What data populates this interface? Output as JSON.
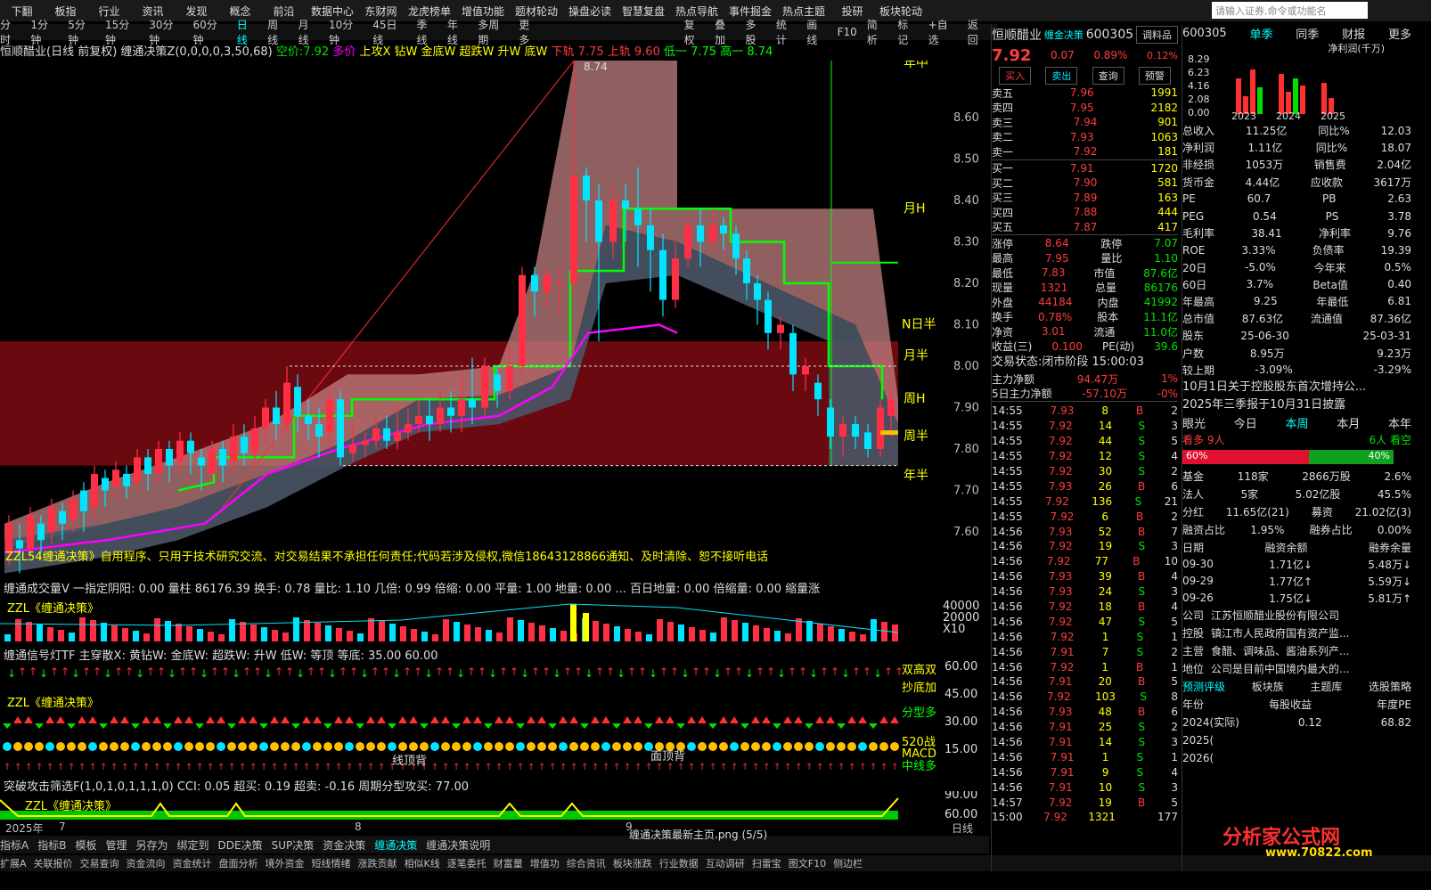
{
  "toolbar": {
    "items": [
      "下翻",
      "板指",
      "行业",
      "资讯",
      "发现",
      "概念",
      "前沿",
      "数据中心",
      "东财网",
      "龙虎榜单",
      "增值功能",
      "题材轮动",
      "操盘必读",
      "智慧复盘",
      "热点导航",
      "事件掘金",
      "热点主题",
      "投研",
      "板块轮动"
    ],
    "search_placeholder": "请输入证券,命令或功能名"
  },
  "periods": [
    "分时",
    "1分钟",
    "5分钟",
    "15分钟",
    "30分钟",
    "60分钟",
    "日线",
    "周线",
    "月线",
    "10分钟",
    "45日线",
    "季线",
    "年线",
    "多周期",
    "更多"
  ],
  "period_tools": [
    "复权",
    "叠加",
    "多股",
    "统计",
    "画线",
    "F10",
    "简析",
    "标记",
    "+自选",
    "返回"
  ],
  "title": {
    "name": "恒顺醋业(日线 前复权)",
    "indicator": "缠通决策Z(0,0,0,0,3,50,68)",
    "price_label": "空价:",
    "price": "7.92",
    "tags": [
      "多价",
      "上攻X",
      "钻W",
      "金底W",
      "超跌W",
      "升W",
      "底W",
      "下轨",
      "7.75",
      "上轨",
      "9.60",
      "低一",
      "7.75",
      "高一",
      "8.74"
    ]
  },
  "price_axis": [
    "8.60",
    "8.50",
    "8.40",
    "8.30",
    "8.20",
    "8.10",
    "8.00",
    "7.90",
    "7.80",
    "7.70",
    "7.60"
  ],
  "chart_data": {
    "type": "candlestick",
    "high_label": "8.74",
    "level_labels": [
      "年中",
      "月H",
      "N日半",
      "月半",
      "周H",
      "周半",
      "年半"
    ]
  },
  "disclaimer": "ZZL54缠通决策》自用程序、只用于技术研究交流、对交易结果不承担任何责任;代码若涉及侵权,微信18643128866通知、及时清除、恕不接听电话",
  "vol_title": "缠通成交量V 一指定阴阳: 0.00 量柱 86176.39 换手: 0.78 量比: 1.10 几倍: 0.99 倍缩: 0.00 平量: 1.00 地量: 0.00 ... 百日地量: 0.00 倍缩量: 0.00 缩量涨",
  "vol_sub": "ZZL《缠通决策》",
  "vol_axis": [
    "40000",
    "20000",
    "X10"
  ],
  "sig_title": "缠通信号灯TF 主穿散X: 黄钻W: 金底W: 超跌W: 升W 低W: 等顶 等底: 35.00 60.00",
  "sig_sub": "ZZL《缠通决策》",
  "sig_axis": [
    "60.00",
    "45.00",
    "30.00",
    "15.00"
  ],
  "sig_labels": [
    "双高双",
    "抄底加",
    "分型多",
    "520战",
    "MACD",
    "中线多",
    "线顶背",
    "面顶背"
  ],
  "cci_title": "突破攻击筛选F(1,0,1,0,1,1,1,0) CCI: 0.05 超买: 0.19 超卖: -0.16 周期分型攻买: 77.00",
  "cci_sub": "ZZL《缠通决策》",
  "cci_axis": [
    "90.00",
    "60.00"
  ],
  "time_axis": [
    "2025年",
    "7",
    "8",
    "9"
  ],
  "time_right": "日线",
  "tabs": [
    "指标A",
    "指标B",
    "模板",
    "管理",
    "另存为",
    "绑定到",
    "DDE决策",
    "SUP决策",
    "资金决策",
    "缠通决策",
    "缠通决策说明"
  ],
  "file_label": "缠通决策最新主页.png (5/5)",
  "bottom_tabs": [
    "扩展A",
    "关联报价",
    "交易查询",
    "资金流向",
    "资金统计",
    "盘面分析",
    "境外资金",
    "短线情绪",
    "涨跌贡献",
    "相似K线",
    "逐笔委托",
    "财富量",
    "增值功",
    "综合资讯",
    "板块涨跌",
    "行业数据",
    "互动调研",
    "扫雷宝",
    "图文F10",
    "侧边栏"
  ],
  "quote": {
    "name": "恒顺醋业",
    "tag": "缠金决策",
    "code": "600305",
    "rz": "R",
    "mode": "调料品",
    "price": "7.92",
    "chg": "0.07",
    "pct": "0.89%",
    "pct2": "0.12%",
    "buttons": [
      "买入",
      "卖出",
      "查询",
      "预警"
    ],
    "asks": [
      [
        "卖五",
        "7.96",
        "1991"
      ],
      [
        "卖四",
        "7.95",
        "2182"
      ],
      [
        "卖三",
        "7.94",
        "901"
      ],
      [
        "卖二",
        "7.93",
        "1063"
      ],
      [
        "卖一",
        "7.92",
        "181"
      ]
    ],
    "bids": [
      [
        "买一",
        "7.91",
        "1720"
      ],
      [
        "买二",
        "7.90",
        "581"
      ],
      [
        "买三",
        "7.89",
        "163"
      ],
      [
        "买四",
        "7.88",
        "444"
      ],
      [
        "买五",
        "7.87",
        "417"
      ]
    ],
    "stats": [
      [
        "涨停",
        "8.64",
        "跌停",
        "7.07"
      ],
      [
        "最高",
        "7.95",
        "量比",
        "1.10"
      ],
      [
        "最低",
        "7.83",
        "市值",
        "87.6亿"
      ],
      [
        "现量",
        "1321",
        "总量",
        "86176"
      ],
      [
        "外盘",
        "44184",
        "内盘",
        "41992"
      ],
      [
        "换手",
        "0.78%",
        "股本",
        "11.1亿"
      ],
      [
        "净资",
        "3.01",
        "流通",
        "11.0亿"
      ],
      [
        "收益(三)",
        "0.100",
        "PE(动)",
        "39.6"
      ]
    ],
    "status": "交易状态:闭市阶段 15:00:03",
    "flow": [
      [
        "主力净额",
        "94.47万",
        "1%"
      ],
      [
        "5日主力净额",
        "-57.10万",
        "-0%"
      ]
    ],
    "ticks": [
      [
        "14:55",
        "7.93",
        "8",
        "B",
        "2"
      ],
      [
        "14:55",
        "7.92",
        "14",
        "S",
        "3"
      ],
      [
        "14:55",
        "7.92",
        "44",
        "S",
        "5"
      ],
      [
        "14:55",
        "7.92",
        "12",
        "S",
        "4"
      ],
      [
        "14:55",
        "7.92",
        "30",
        "S",
        "2"
      ],
      [
        "14:55",
        "7.93",
        "26",
        "B",
        "6"
      ],
      [
        "14:55",
        "7.92",
        "136",
        "S",
        "21"
      ],
      [
        "14:55",
        "7.92",
        "6",
        "B",
        "2"
      ],
      [
        "14:56",
        "7.93",
        "52",
        "B",
        "7"
      ],
      [
        "14:56",
        "7.92",
        "19",
        "S",
        "3"
      ],
      [
        "14:56",
        "7.92",
        "77",
        "B",
        "10"
      ],
      [
        "14:56",
        "7.93",
        "39",
        "B",
        "4"
      ],
      [
        "14:56",
        "7.93",
        "24",
        "S",
        "3"
      ],
      [
        "14:56",
        "7.92",
        "18",
        "B",
        "4"
      ],
      [
        "14:56",
        "7.92",
        "47",
        "S",
        "5"
      ],
      [
        "14:56",
        "7.92",
        "1",
        "S",
        "1"
      ],
      [
        "14:56",
        "7.91",
        "7",
        "S",
        "2"
      ],
      [
        "14:56",
        "7.92",
        "1",
        "B",
        "1"
      ],
      [
        "14:56",
        "7.91",
        "20",
        "B",
        "5"
      ],
      [
        "14:56",
        "7.92",
        "103",
        "S",
        "8"
      ],
      [
        "14:56",
        "7.93",
        "48",
        "B",
        "6"
      ],
      [
        "14:56",
        "7.91",
        "25",
        "S",
        "2"
      ],
      [
        "14:56",
        "7.91",
        "14",
        "S",
        "3"
      ],
      [
        "14:56",
        "7.91",
        "1",
        "S",
        "1"
      ],
      [
        "14:56",
        "7.91",
        "9",
        "S",
        "4"
      ],
      [
        "14:56",
        "7.91",
        "10",
        "S",
        "3"
      ],
      [
        "14:57",
        "7.92",
        "19",
        "B",
        "5"
      ],
      [
        "15:00",
        "7.92",
        "1321",
        "",
        "177"
      ]
    ]
  },
  "fin": {
    "code": "600305",
    "tabs": [
      "单季",
      "同季",
      "财报",
      "更多"
    ],
    "unit": "净利润(千万)",
    "axis": [
      "8.29",
      "6.23",
      "4.16",
      "2.08",
      "0.00"
    ],
    "years": [
      "2023",
      "2024",
      "2025"
    ],
    "rows": [
      [
        "总收入",
        "11.25亿",
        "同比%",
        "12.03"
      ],
      [
        "净利润",
        "1.11亿",
        "同比%",
        "18.07"
      ],
      [
        "非经损",
        "1053万",
        "销售费",
        "2.04亿"
      ],
      [
        "货币金",
        "4.44亿",
        "应收款",
        "3617万"
      ],
      [
        "PE",
        "60.7",
        "PB",
        "2.63"
      ],
      [
        "PEG",
        "0.54",
        "PS",
        "3.78"
      ],
      [
        "毛利率",
        "38.41",
        "净利率",
        "9.76"
      ],
      [
        "ROE",
        "3.33%",
        "负债率",
        "19.39"
      ],
      [
        "20日",
        "-5.0%",
        "今年来",
        "0.5%"
      ],
      [
        "60日",
        "3.7%",
        "Beta值",
        "0.40"
      ],
      [
        "年最高",
        "9.25",
        "年最低",
        "6.81"
      ],
      [
        "总市值",
        "87.63亿",
        "流通值",
        "87.36亿"
      ],
      [
        "股东",
        "25-06-30",
        "",
        "25-03-31"
      ],
      [
        "户数",
        "8.95万",
        "",
        "9.23万"
      ],
      [
        "较上期",
        "-3.09%",
        "",
        "-3.29%"
      ]
    ],
    "news": [
      "10月1日关于控股股东首次增持公...",
      "2025年三季报于10月31日披露"
    ],
    "eye": {
      "label": "眼光",
      "tabs": [
        "今日",
        "本周",
        "本月",
        "本年"
      ],
      "left": "看多 9人",
      "right": "6人 看空",
      "pct_left": "60%",
      "pct_right": "40%"
    },
    "funds": [
      [
        "基金",
        "118家",
        "2866万股",
        "2.6%"
      ],
      [
        "法人",
        "5家",
        "5.02亿股",
        "45.5%"
      ],
      [
        "分红",
        "11.65亿(21)",
        "募资",
        "21.02亿(3)"
      ],
      [
        "融资占比",
        "1.95%",
        "融券占比",
        "0.00%"
      ]
    ],
    "margin_head": [
      "日期",
      "融资余额",
      "融券余量"
    ],
    "margin": [
      [
        "09-30",
        "1.71亿↓",
        "5.48万↓"
      ],
      [
        "09-29",
        "1.77亿↑",
        "5.59万↓"
      ],
      [
        "09-26",
        "1.75亿↓",
        "5.81万↑"
      ]
    ],
    "company": [
      [
        "公司",
        "江苏恒顺醋业股份有限公司"
      ],
      [
        "控股",
        "镇江市人民政府国有资产监..."
      ],
      [
        "主营",
        "食醋、调味品、酱油系列产..."
      ],
      [
        "地位",
        "公司是目前中国境内最大的..."
      ]
    ],
    "links": [
      "预测评级",
      "板块族",
      "主题库",
      "选股策略"
    ],
    "eps_head": [
      "年份",
      "每股收益",
      "年度PE"
    ],
    "eps": [
      [
        "2024(实际)",
        "0.12",
        "68.82"
      ],
      [
        "2025(",
        "",
        ""
      ],
      [
        "2026(",
        "",
        ""
      ]
    ],
    "watermark": "分析家公式网",
    "watermark_url": "www.70822.com"
  }
}
